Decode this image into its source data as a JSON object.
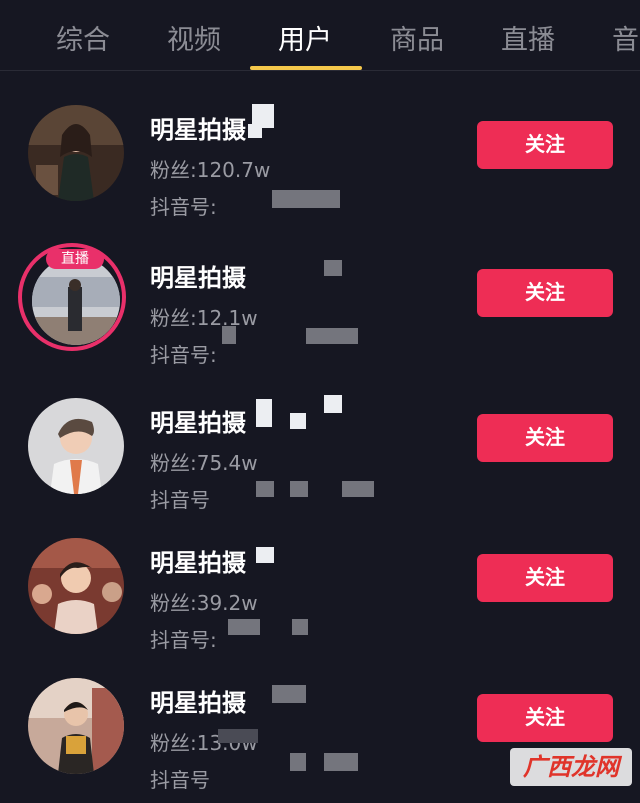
{
  "tabs": [
    {
      "label": "综合"
    },
    {
      "label": "视频"
    },
    {
      "label": "用户"
    },
    {
      "label": "商品"
    },
    {
      "label": "直播"
    },
    {
      "label": "音"
    }
  ],
  "active_tab": "用户",
  "users": [
    {
      "name": "明星拍摄",
      "fans": "粉丝:120.7w",
      "douyin_id": "抖音号:",
      "follow_label": "关注"
    },
    {
      "name": "明星拍摄",
      "fans": "粉丝:12.1w",
      "douyin_id": "抖音号:",
      "follow_label": "关注",
      "live_badge": "直播"
    },
    {
      "name": "明星拍摄",
      "fans": "粉丝:75.4w",
      "douyin_id": "抖音号",
      "follow_label": "关注"
    },
    {
      "name": "明星拍摄",
      "fans": "粉丝:39.2w",
      "douyin_id": "抖音号:",
      "follow_label": "关注"
    },
    {
      "name": "明星拍摄",
      "fans": "粉丝:13.0w",
      "douyin_id": "抖音号",
      "follow_label": "关注"
    }
  ],
  "watermark": "广西龙网",
  "colors": {
    "background": "#161722",
    "follow_button": "#ee2d55",
    "tab_indicator": "#f5c84b",
    "live": "#e9306a"
  }
}
